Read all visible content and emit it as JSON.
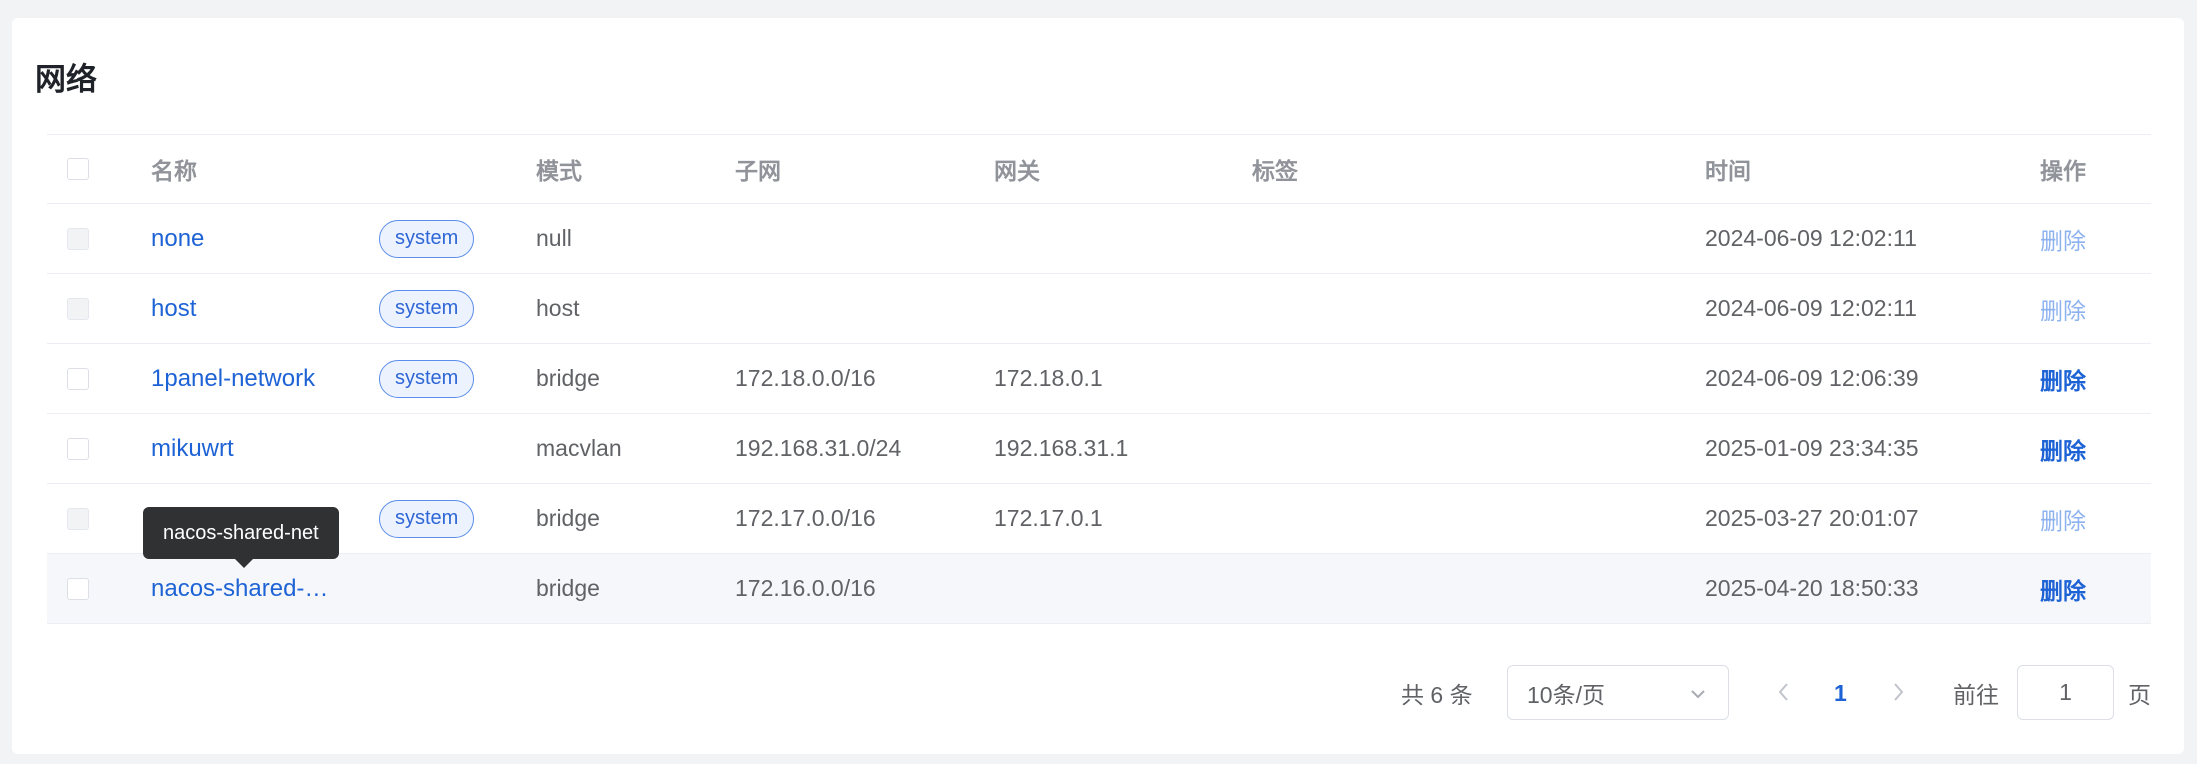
{
  "page": {
    "title": "网络"
  },
  "table": {
    "headers": {
      "name": "名称",
      "mode": "模式",
      "subnet": "子网",
      "gateway": "网关",
      "labels": "标签",
      "time": "时间",
      "actions": "操作"
    },
    "rows": [
      {
        "name": "none",
        "tag": "system",
        "mode": "null",
        "subnet": "",
        "gateway": "",
        "labels": "",
        "time": "2024-06-09 12:02:11",
        "action": "删除",
        "action_disabled": true,
        "check_disabled": true
      },
      {
        "name": "host",
        "tag": "system",
        "mode": "host",
        "subnet": "",
        "gateway": "",
        "labels": "",
        "time": "2024-06-09 12:02:11",
        "action": "删除",
        "action_disabled": true,
        "check_disabled": true
      },
      {
        "name": "1panel-network",
        "tag": "system",
        "mode": "bridge",
        "subnet": "172.18.0.0/16",
        "gateway": "172.18.0.1",
        "labels": "",
        "time": "2024-06-09 12:06:39",
        "action": "删除",
        "action_disabled": false,
        "check_disabled": false
      },
      {
        "name": "mikuwrt",
        "tag": "",
        "mode": "macvlan",
        "subnet": "192.168.31.0/24",
        "gateway": "192.168.31.1",
        "labels": "",
        "time": "2025-01-09 23:34:35",
        "action": "删除",
        "action_disabled": false,
        "check_disabled": false
      },
      {
        "name": "",
        "tag": "system",
        "mode": "bridge",
        "subnet": "172.17.0.0/16",
        "gateway": "172.17.0.1",
        "labels": "",
        "time": "2025-03-27 20:01:07",
        "action": "删除",
        "action_disabled": true,
        "check_disabled": true
      },
      {
        "name": "nacos-shared-…",
        "tag": "",
        "mode": "bridge",
        "subnet": "172.16.0.0/16",
        "gateway": "",
        "labels": "",
        "time": "2025-04-20 18:50:33",
        "action": "删除",
        "action_disabled": false,
        "check_disabled": false
      }
    ]
  },
  "tooltip": {
    "text": "nacos-shared-net"
  },
  "pagination": {
    "total_text": "共 6 条",
    "page_size": "10条/页",
    "current_page": "1",
    "goto_label": "前往",
    "goto_value": "1",
    "goto_suffix": "页"
  },
  "icons": {
    "prev": "chevron-left-icon",
    "next": "chevron-right-icon",
    "dropdown": "chevron-down-icon"
  },
  "colors": {
    "link": "#1e63d5",
    "link_disabled": "#8db2f0",
    "tag_border": "#5b8dea",
    "tag_bg": "#ecf3ff",
    "tooltip_bg": "#303133"
  }
}
